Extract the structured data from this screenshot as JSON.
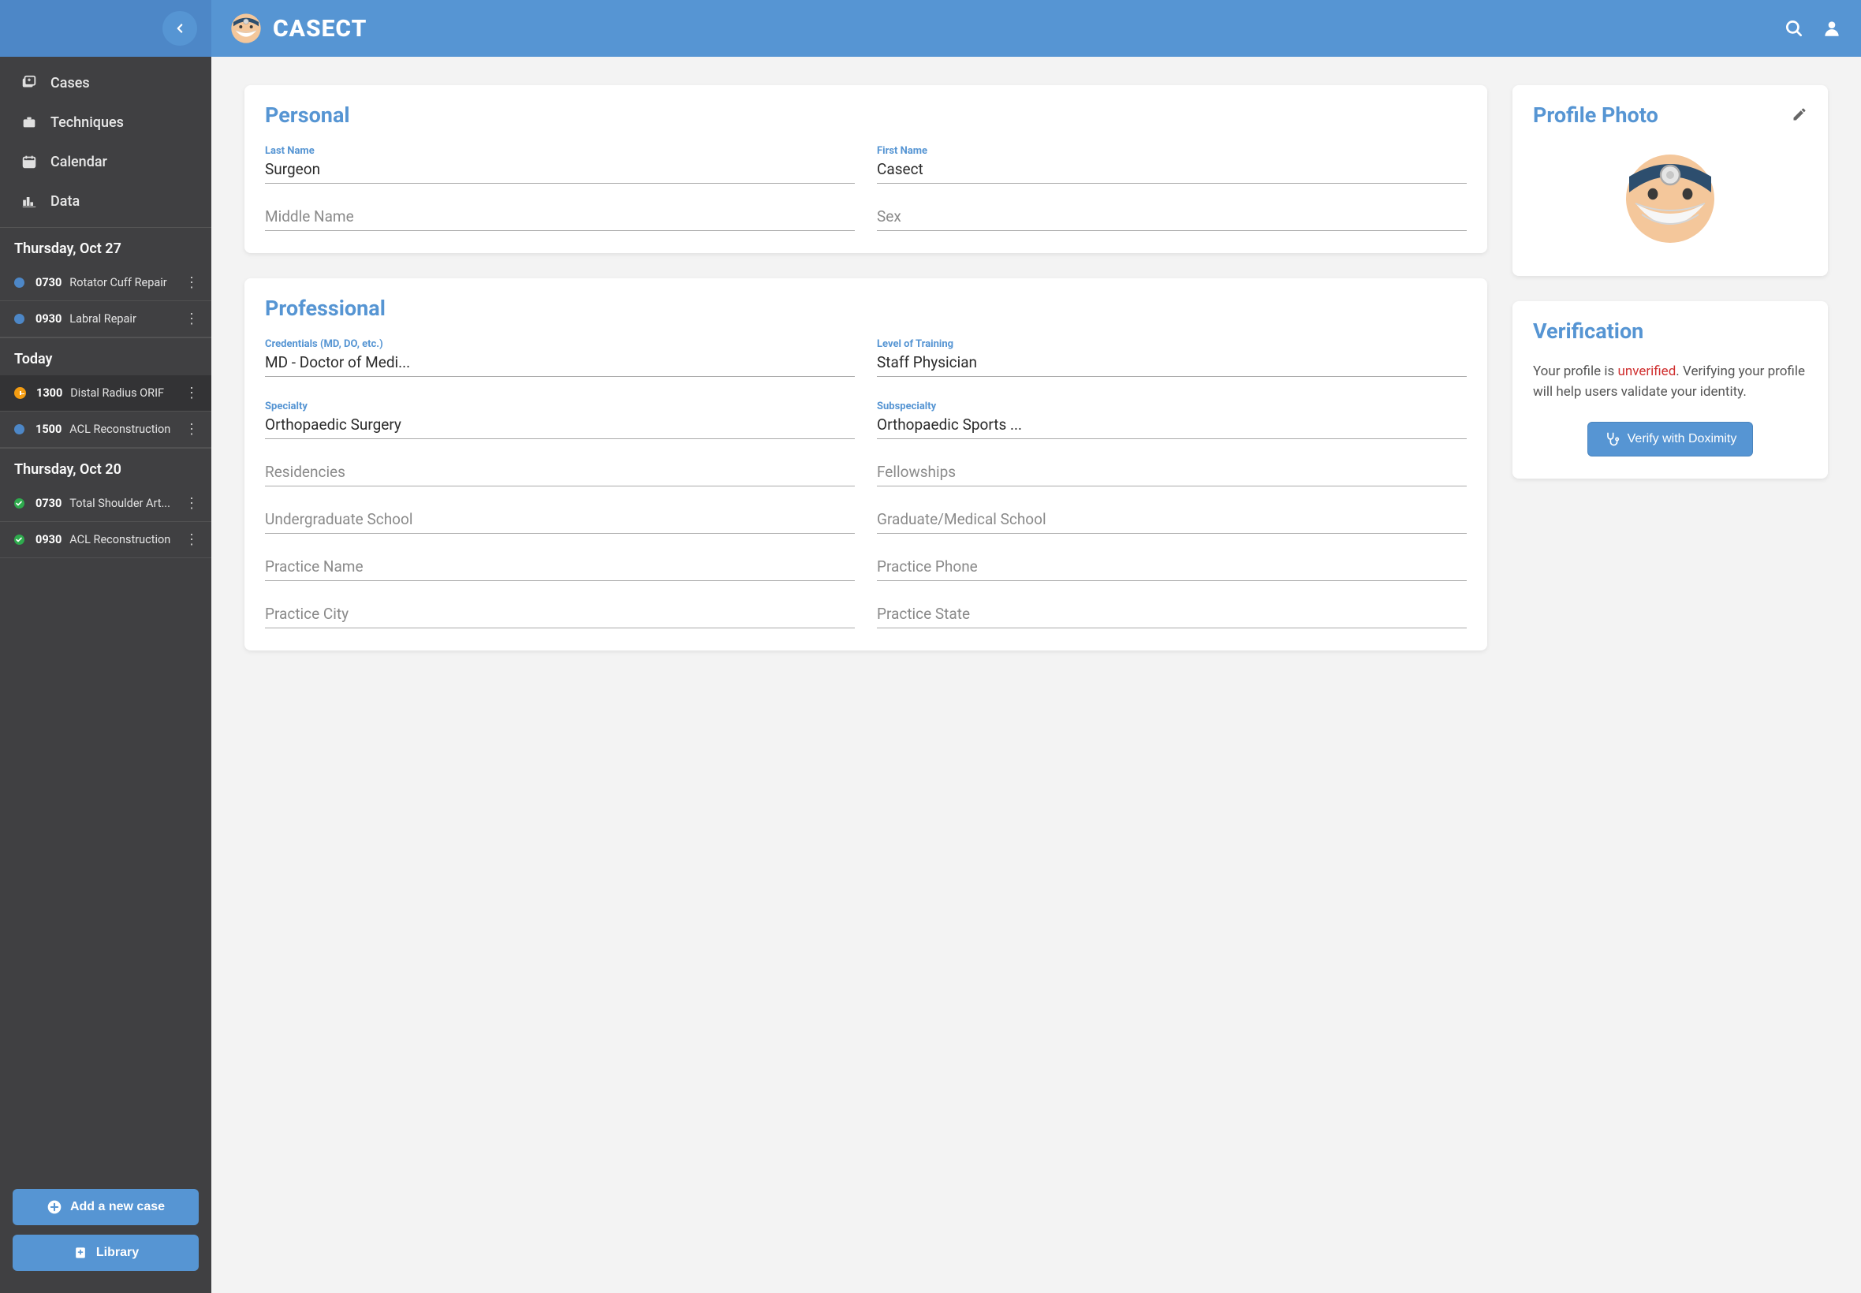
{
  "app": {
    "title": "CASECT"
  },
  "sidebar": {
    "nav": [
      {
        "label": "Cases",
        "icon": "cases-icon"
      },
      {
        "label": "Techniques",
        "icon": "techniques-icon"
      },
      {
        "label": "Calendar",
        "icon": "calendar-icon"
      },
      {
        "label": "Data",
        "icon": "data-icon"
      }
    ],
    "sections": [
      {
        "header": "Thursday, Oct 27",
        "items": [
          {
            "status": "blue",
            "time": "0730",
            "name": "Rotator Cuff Repair"
          },
          {
            "status": "blue",
            "time": "0930",
            "name": "Labral Repair"
          }
        ]
      },
      {
        "header": "Today",
        "items": [
          {
            "status": "clock",
            "time": "1300",
            "name": "Distal Radius ORIF",
            "active": true
          },
          {
            "status": "blue",
            "time": "1500",
            "name": "ACL Reconstruction"
          }
        ]
      },
      {
        "header": "Thursday, Oct 20",
        "items": [
          {
            "status": "green",
            "time": "0730",
            "name": "Total Shoulder Art..."
          },
          {
            "status": "green",
            "time": "0930",
            "name": "ACL Reconstruction"
          }
        ]
      }
    ],
    "add_case_label": "Add a new case",
    "library_label": "Library"
  },
  "cards": {
    "personal": {
      "title": "Personal",
      "last_name_label": "Last Name",
      "last_name_value": "Surgeon",
      "first_name_label": "First Name",
      "first_name_value": "Casect",
      "middle_name_placeholder": "Middle Name",
      "sex_placeholder": "Sex"
    },
    "professional": {
      "title": "Professional",
      "credentials_label": "Credentials (MD, DO, etc.)",
      "credentials_value": "MD - Doctor of Medi...",
      "training_label": "Level of Training",
      "training_value": "Staff Physician",
      "specialty_label": "Specialty",
      "specialty_value": "Orthopaedic Surgery",
      "subspecialty_label": "Subspecialty",
      "subspecialty_value": "Orthopaedic Sports ...",
      "residencies_placeholder": "Residencies",
      "fellowships_placeholder": "Fellowships",
      "undergrad_placeholder": "Undergraduate School",
      "medschool_placeholder": "Graduate/Medical School",
      "practice_name_placeholder": "Practice Name",
      "practice_phone_placeholder": "Practice Phone",
      "practice_city_placeholder": "Practice City",
      "practice_state_placeholder": "Practice State"
    },
    "photo": {
      "title": "Profile Photo"
    },
    "verification": {
      "title": "Verification",
      "text_prefix": "Your profile is ",
      "status": "unverified",
      "text_suffix": ". Verifying your profile will help users validate your identity.",
      "button_label": "Verify with Doximity"
    }
  }
}
